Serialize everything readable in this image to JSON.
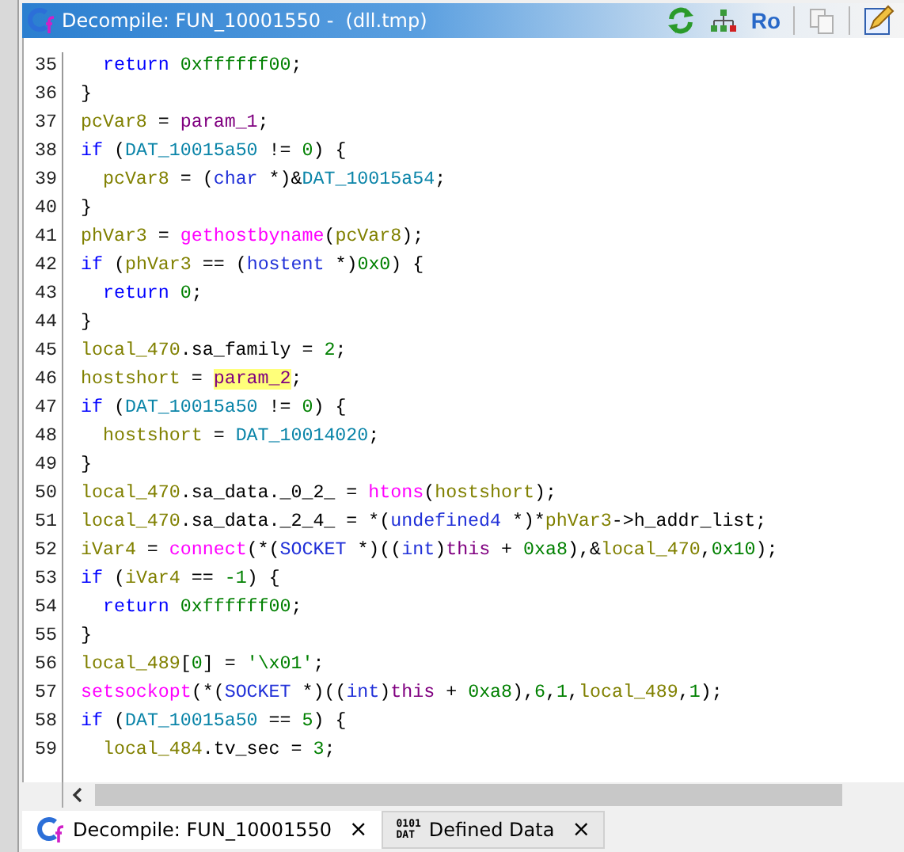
{
  "window": {
    "title": "Decompile: FUN_10001550 -  (dll.tmp)"
  },
  "toolbar": [
    {
      "kind": "refresh"
    },
    {
      "kind": "graph"
    },
    {
      "kind": "text",
      "label": "Ro"
    },
    {
      "kind": "copy",
      "disabled": true
    },
    {
      "kind": "edit"
    }
  ],
  "code": [
    {
      "number": "35",
      "tokens": [
        {
          "text": "  return ",
          "kind": "keyword"
        },
        {
          "text": "0xffffff00",
          "kind": "const"
        },
        {
          "text": ";",
          "kind": "plain"
        }
      ]
    },
    {
      "number": "36",
      "tokens": [
        {
          "text": "}",
          "kind": "plain"
        }
      ]
    },
    {
      "number": "37",
      "tokens": [
        {
          "text": "pcVar8",
          "kind": "var"
        },
        {
          "text": " = ",
          "kind": "plain"
        },
        {
          "text": "param_1",
          "kind": "param"
        },
        {
          "text": ";",
          "kind": "plain"
        }
      ]
    },
    {
      "number": "38",
      "tokens": [
        {
          "text": "if",
          "kind": "keyword"
        },
        {
          "text": " (",
          "kind": "plain"
        },
        {
          "text": "DAT_10015a50",
          "kind": "global"
        },
        {
          "text": " != ",
          "kind": "plain"
        },
        {
          "text": "0",
          "kind": "const"
        },
        {
          "text": ") {",
          "kind": "plain"
        }
      ]
    },
    {
      "number": "39",
      "tokens": [
        {
          "text": "  pcVar8",
          "kind": "var"
        },
        {
          "text": " = (",
          "kind": "plain"
        },
        {
          "text": "char",
          "kind": "type"
        },
        {
          "text": " *)&",
          "kind": "plain"
        },
        {
          "text": "DAT_10015a54",
          "kind": "global"
        },
        {
          "text": ";",
          "kind": "plain"
        }
      ]
    },
    {
      "number": "40",
      "tokens": [
        {
          "text": "}",
          "kind": "plain"
        }
      ]
    },
    {
      "number": "41",
      "tokens": [
        {
          "text": "phVar3",
          "kind": "var"
        },
        {
          "text": " = ",
          "kind": "plain"
        },
        {
          "text": "gethostbyname",
          "kind": "func"
        },
        {
          "text": "(",
          "kind": "plain"
        },
        {
          "text": "pcVar8",
          "kind": "var"
        },
        {
          "text": ");",
          "kind": "plain"
        }
      ]
    },
    {
      "number": "42",
      "tokens": [
        {
          "text": "if",
          "kind": "keyword"
        },
        {
          "text": " (",
          "kind": "plain"
        },
        {
          "text": "phVar3",
          "kind": "var"
        },
        {
          "text": " == (",
          "kind": "plain"
        },
        {
          "text": "hostent",
          "kind": "type"
        },
        {
          "text": " *)",
          "kind": "plain"
        },
        {
          "text": "0x0",
          "kind": "const"
        },
        {
          "text": ") {",
          "kind": "plain"
        }
      ]
    },
    {
      "number": "43",
      "tokens": [
        {
          "text": "  return ",
          "kind": "keyword"
        },
        {
          "text": "0",
          "kind": "const"
        },
        {
          "text": ";",
          "kind": "plain"
        }
      ]
    },
    {
      "number": "44",
      "tokens": [
        {
          "text": "}",
          "kind": "plain"
        }
      ]
    },
    {
      "number": "45",
      "tokens": [
        {
          "text": "local_470",
          "kind": "var"
        },
        {
          "text": ".sa_family = ",
          "kind": "plain"
        },
        {
          "text": "2",
          "kind": "const"
        },
        {
          "text": ";",
          "kind": "plain"
        }
      ]
    },
    {
      "number": "46",
      "tokens": [
        {
          "text": "hostshort",
          "kind": "var"
        },
        {
          "text": " = ",
          "kind": "plain"
        },
        {
          "text": "param_2",
          "kind": "param",
          "highlighted": true
        },
        {
          "text": ";",
          "kind": "plain"
        }
      ]
    },
    {
      "number": "47",
      "tokens": [
        {
          "text": "if",
          "kind": "keyword"
        },
        {
          "text": " (",
          "kind": "plain"
        },
        {
          "text": "DAT_10015a50",
          "kind": "global"
        },
        {
          "text": " != ",
          "kind": "plain"
        },
        {
          "text": "0",
          "kind": "const"
        },
        {
          "text": ") {",
          "kind": "plain"
        }
      ]
    },
    {
      "number": "48",
      "tokens": [
        {
          "text": "  hostshort",
          "kind": "var"
        },
        {
          "text": " = ",
          "kind": "plain"
        },
        {
          "text": "DAT_10014020",
          "kind": "global"
        },
        {
          "text": ";",
          "kind": "plain"
        }
      ]
    },
    {
      "number": "49",
      "tokens": [
        {
          "text": "}",
          "kind": "plain"
        }
      ]
    },
    {
      "number": "50",
      "tokens": [
        {
          "text": "local_470",
          "kind": "var"
        },
        {
          "text": ".sa_data._0_2_ = ",
          "kind": "plain"
        },
        {
          "text": "htons",
          "kind": "func"
        },
        {
          "text": "(",
          "kind": "plain"
        },
        {
          "text": "hostshort",
          "kind": "var"
        },
        {
          "text": ");",
          "kind": "plain"
        }
      ]
    },
    {
      "number": "51",
      "tokens": [
        {
          "text": "local_470",
          "kind": "var"
        },
        {
          "text": ".sa_data._2_4_ = *(",
          "kind": "plain"
        },
        {
          "text": "undefined4",
          "kind": "type"
        },
        {
          "text": " *)*",
          "kind": "plain"
        },
        {
          "text": "phVar3",
          "kind": "var"
        },
        {
          "text": "->h_addr_list;",
          "kind": "plain"
        }
      ]
    },
    {
      "number": "52",
      "tokens": [
        {
          "text": "iVar4",
          "kind": "var"
        },
        {
          "text": " = ",
          "kind": "plain"
        },
        {
          "text": "connect",
          "kind": "func"
        },
        {
          "text": "(*(",
          "kind": "plain"
        },
        {
          "text": "SOCKET",
          "kind": "type"
        },
        {
          "text": " *)((",
          "kind": "plain"
        },
        {
          "text": "int",
          "kind": "type"
        },
        {
          "text": ")",
          "kind": "plain"
        },
        {
          "text": "this",
          "kind": "param"
        },
        {
          "text": " + ",
          "kind": "plain"
        },
        {
          "text": "0xa8",
          "kind": "const"
        },
        {
          "text": "),&",
          "kind": "plain"
        },
        {
          "text": "local_470",
          "kind": "var"
        },
        {
          "text": ",",
          "kind": "plain"
        },
        {
          "text": "0x10",
          "kind": "const"
        },
        {
          "text": ");",
          "kind": "plain"
        }
      ]
    },
    {
      "number": "53",
      "tokens": [
        {
          "text": "if",
          "kind": "keyword"
        },
        {
          "text": " (",
          "kind": "plain"
        },
        {
          "text": "iVar4",
          "kind": "var"
        },
        {
          "text": " == ",
          "kind": "plain"
        },
        {
          "text": "-1",
          "kind": "const"
        },
        {
          "text": ") {",
          "kind": "plain"
        }
      ]
    },
    {
      "number": "54",
      "tokens": [
        {
          "text": "  return ",
          "kind": "keyword"
        },
        {
          "text": "0xffffff00",
          "kind": "const"
        },
        {
          "text": ";",
          "kind": "plain"
        }
      ]
    },
    {
      "number": "55",
      "tokens": [
        {
          "text": "}",
          "kind": "plain"
        }
      ]
    },
    {
      "number": "56",
      "tokens": [
        {
          "text": "local_489",
          "kind": "var"
        },
        {
          "text": "[",
          "kind": "plain"
        },
        {
          "text": "0",
          "kind": "const"
        },
        {
          "text": "] = ",
          "kind": "plain"
        },
        {
          "text": "'\\x01'",
          "kind": "const"
        },
        {
          "text": ";",
          "kind": "plain"
        }
      ]
    },
    {
      "number": "57",
      "tokens": [
        {
          "text": "setsockopt",
          "kind": "func"
        },
        {
          "text": "(*(",
          "kind": "plain"
        },
        {
          "text": "SOCKET",
          "kind": "type"
        },
        {
          "text": " *)((",
          "kind": "plain"
        },
        {
          "text": "int",
          "kind": "type"
        },
        {
          "text": ")",
          "kind": "plain"
        },
        {
          "text": "this",
          "kind": "param"
        },
        {
          "text": " + ",
          "kind": "plain"
        },
        {
          "text": "0xa8",
          "kind": "const"
        },
        {
          "text": "),",
          "kind": "plain"
        },
        {
          "text": "6",
          "kind": "const"
        },
        {
          "text": ",",
          "kind": "plain"
        },
        {
          "text": "1",
          "kind": "const"
        },
        {
          "text": ",",
          "kind": "plain"
        },
        {
          "text": "local_489",
          "kind": "var"
        },
        {
          "text": ",",
          "kind": "plain"
        },
        {
          "text": "1",
          "kind": "const"
        },
        {
          "text": ");",
          "kind": "plain"
        }
      ]
    },
    {
      "number": "58",
      "tokens": [
        {
          "text": "if",
          "kind": "keyword"
        },
        {
          "text": " (",
          "kind": "plain"
        },
        {
          "text": "DAT_10015a50",
          "kind": "global"
        },
        {
          "text": " == ",
          "kind": "plain"
        },
        {
          "text": "5",
          "kind": "const"
        },
        {
          "text": ") {",
          "kind": "plain"
        }
      ]
    },
    {
      "number": "59",
      "tokens": [
        {
          "text": "  local_484",
          "kind": "var"
        },
        {
          "text": ".tv_sec = ",
          "kind": "plain"
        },
        {
          "text": "3",
          "kind": "const"
        },
        {
          "text": ";",
          "kind": "plain"
        }
      ]
    }
  ],
  "tabs": [
    {
      "kind": "decompile",
      "label": "Decompile: FUN_10001550",
      "selected": true,
      "close": "×"
    },
    {
      "kind": "data",
      "icon_lines": [
        "0101",
        "DAT"
      ],
      "label": "Defined Data",
      "selected": false,
      "close": "×"
    }
  ]
}
